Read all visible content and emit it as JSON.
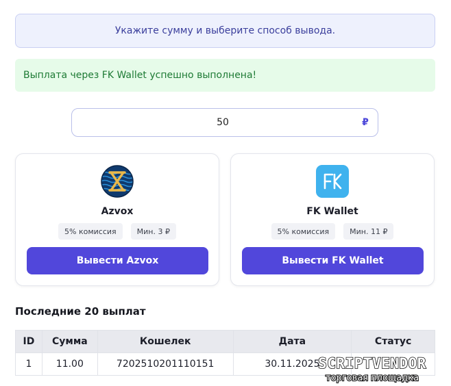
{
  "info_banner": {
    "text": "Укажите сумму и выберите способ вывода."
  },
  "success_banner": {
    "text": "Выплата через FK Wallet успешно выполнена!"
  },
  "amount": {
    "value": "50",
    "currency_symbol": "₽"
  },
  "methods": [
    {
      "name": "Azvox",
      "logo_icon": "azvox-logo-icon",
      "commission": "5% комиссия",
      "min": "Мин. 3 ₽",
      "button_label": "Вывести Azvox"
    },
    {
      "name": "FK Wallet",
      "logo_icon": "fk-wallet-logo-icon",
      "commission": "5% комиссия",
      "min": "Мин. 11 ₽",
      "button_label": "Вывести FK Wallet"
    }
  ],
  "history": {
    "title": "Последние 20 выплат",
    "columns": [
      "ID",
      "Сумма",
      "Кошелек",
      "Дата",
      "Статус"
    ],
    "rows": [
      [
        "1",
        "11.00",
        "7202510201110151",
        "30.11.2025",
        ""
      ]
    ]
  },
  "watermark": {
    "brand": "SCRIPTVENDOR",
    "tagline": "торговая площадка"
  },
  "colors": {
    "accent": "#5147db",
    "success_bg": "#e6fbe9",
    "success_text": "#1d7a34",
    "info_bg": "#eef1fd",
    "fk_logo": "#3fb2ee"
  }
}
